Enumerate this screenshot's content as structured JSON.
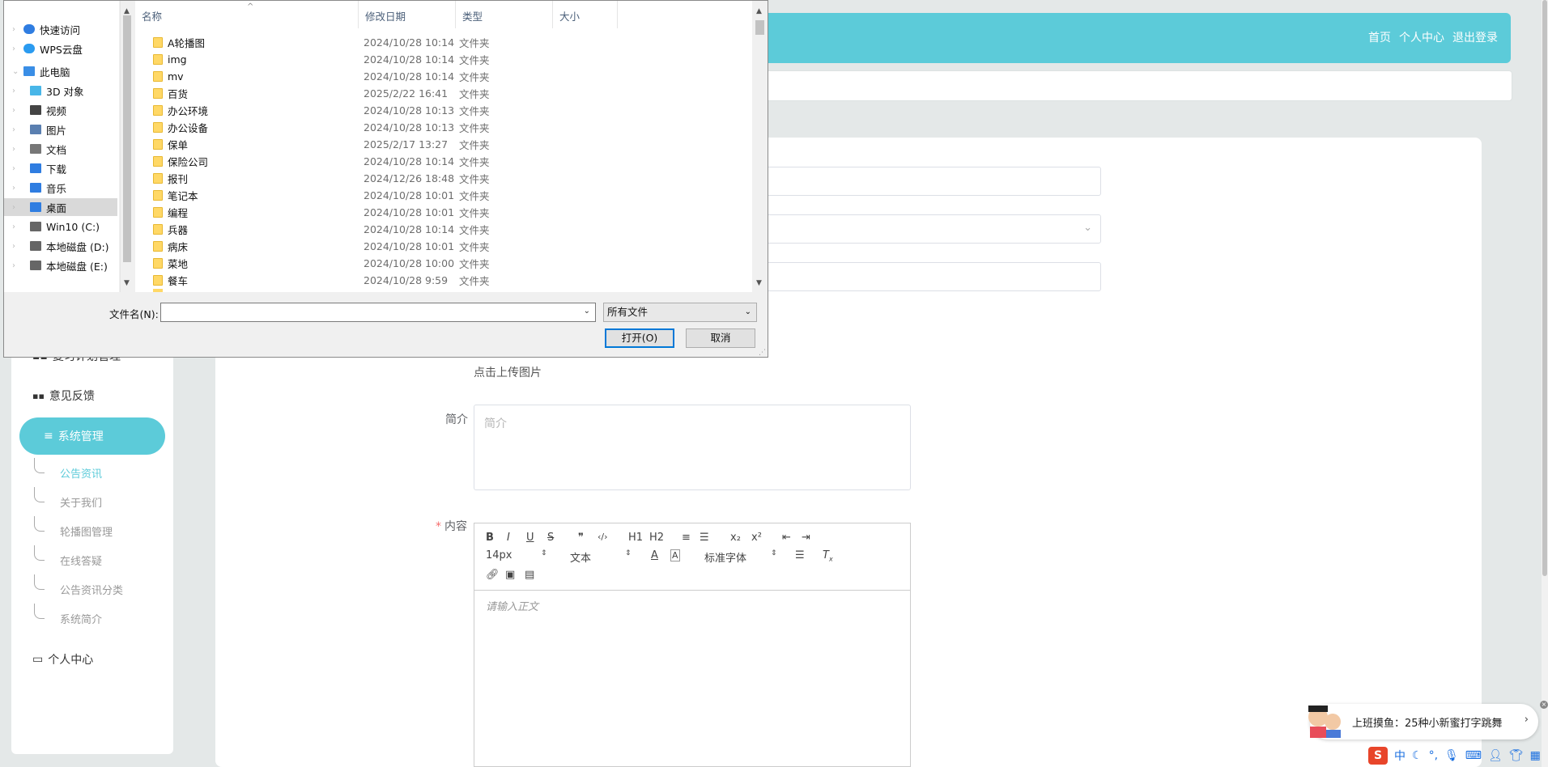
{
  "app": {
    "nav": {
      "home": "首页",
      "profile": "个人中心",
      "logout": "退出登录"
    },
    "sidebar": {
      "item_partial": "复习计划管理",
      "feedback": "意见反馈",
      "system": "系统管理",
      "sub_items": [
        "公告资讯",
        "关于我们",
        "轮播图管理",
        "在线答疑",
        "公告资讯分类",
        "系统简介"
      ],
      "personal": "个人中心"
    },
    "form": {
      "upload_hint": "点击上传图片",
      "intro_label": "简介",
      "intro_placeholder": "简介",
      "content_label": "内容",
      "required_mark": "*",
      "editor": {
        "font_size": "14px",
        "para": "文本",
        "font_family": "标准字体",
        "placeholder": "请输入正文",
        "tools": [
          "B",
          "I",
          "U",
          "S",
          "❞",
          "‹/›",
          "H1",
          "H2",
          "≡",
          "☰",
          "x₂",
          "x²",
          "⇤",
          "⇥"
        ]
      }
    }
  },
  "dialog": {
    "nav": [
      {
        "label": "快速访问",
        "icon": "star-icon"
      },
      {
        "label": "WPS云盘",
        "icon": "cloud-icon"
      },
      {
        "label": "此电脑",
        "icon": "computer-icon"
      },
      {
        "label": "3D 对象",
        "icon": "cube-icon"
      },
      {
        "label": "视频",
        "icon": "video-icon"
      },
      {
        "label": "图片",
        "icon": "pictures-icon"
      },
      {
        "label": "文档",
        "icon": "documents-icon"
      },
      {
        "label": "下载",
        "icon": "download-icon"
      },
      {
        "label": "音乐",
        "icon": "music-icon"
      },
      {
        "label": "桌面",
        "icon": "desktop-icon"
      },
      {
        "label": "Win10 (C:)",
        "icon": "drive-icon"
      },
      {
        "label": "本地磁盘 (D:)",
        "icon": "drive-icon"
      },
      {
        "label": "本地磁盘 (E:)",
        "icon": "drive-icon"
      }
    ],
    "columns": {
      "name": "名称",
      "modified": "修改日期",
      "type": "类型",
      "size": "大小"
    },
    "files": [
      {
        "name": "A轮播图",
        "date": "2024/10/28 10:14",
        "type": "文件夹"
      },
      {
        "name": "img",
        "date": "2024/10/28 10:14",
        "type": "文件夹"
      },
      {
        "name": "mv",
        "date": "2024/10/28 10:14",
        "type": "文件夹"
      },
      {
        "name": "百货",
        "date": "2025/2/22 16:41",
        "type": "文件夹"
      },
      {
        "name": "办公环境",
        "date": "2024/10/28 10:13",
        "type": "文件夹"
      },
      {
        "name": "办公设备",
        "date": "2024/10/28 10:13",
        "type": "文件夹"
      },
      {
        "name": "保单",
        "date": "2025/2/17 13:27",
        "type": "文件夹"
      },
      {
        "name": "保险公司",
        "date": "2024/10/28 10:14",
        "type": "文件夹"
      },
      {
        "name": "报刊",
        "date": "2024/12/26 18:48",
        "type": "文件夹"
      },
      {
        "name": "笔记本",
        "date": "2024/10/28 10:01",
        "type": "文件夹"
      },
      {
        "name": "编程",
        "date": "2024/10/28 10:01",
        "type": "文件夹"
      },
      {
        "name": "兵器",
        "date": "2024/10/28 10:14",
        "type": "文件夹"
      },
      {
        "name": "病床",
        "date": "2024/10/28 10:01",
        "type": "文件夹"
      },
      {
        "name": "菜地",
        "date": "2024/10/28 10:00",
        "type": "文件夹"
      },
      {
        "name": "餐车",
        "date": "2024/10/28 9:59",
        "type": "文件夹"
      }
    ],
    "filename_label": "文件名(N):",
    "filename_value": "",
    "filetype": "所有文件",
    "open": "打开(O)",
    "cancel": "取消"
  },
  "popup": {
    "text": "上班摸鱼：25种小新蜜打字跳舞"
  },
  "ime": {
    "mode": "中"
  }
}
